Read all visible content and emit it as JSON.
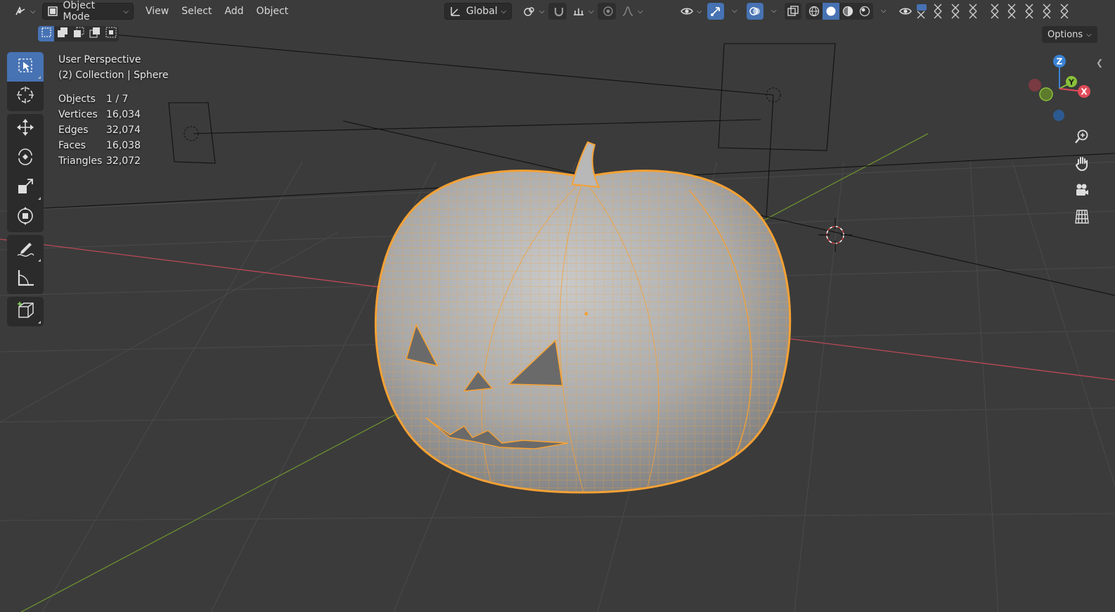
{
  "header": {
    "mode_label": "Object Mode",
    "menus": [
      "View",
      "Select",
      "Add",
      "Object"
    ],
    "transform_orientation": "Global",
    "options_label": "Options"
  },
  "overlay": {
    "view_name": "User Perspective",
    "collection_line": "(2) Collection | Sphere",
    "stats": [
      {
        "label": "Objects",
        "value": "1 / 7"
      },
      {
        "label": "Vertices",
        "value": "16,034"
      },
      {
        "label": "Edges",
        "value": "32,074"
      },
      {
        "label": "Faces",
        "value": "16,038"
      },
      {
        "label": "Triangles",
        "value": "32,072"
      }
    ]
  },
  "gizmo": {
    "x": "X",
    "y": "Y",
    "z": "Z"
  },
  "toolbar": {
    "tools": [
      "select-box-tool",
      "cursor-tool",
      "move-tool",
      "rotate-tool",
      "scale-tool",
      "transform-tool",
      "annotate-tool",
      "measure-tool",
      "add-cube-tool"
    ],
    "active": "select-box-tool"
  },
  "colors": {
    "accent": "#4772b3",
    "selection": "#f5a134",
    "x_axis": "#e04a58",
    "y_axis": "#89c23a",
    "z_axis": "#3b83d6",
    "viewport_bg": "#3b3b3b"
  },
  "icons": {
    "editor_type": "editor-type-icon",
    "mode": "object-mode-icon",
    "orientation": "transform-orientation-icon",
    "pivot": "pivot-point-icon",
    "snap": "snap-magnet-icon",
    "proportional": "proportional-edit-icon",
    "visibility": "eye-icon",
    "gizmo_toggle": "gizmo-toggle-icon",
    "overlays": "overlays-icon",
    "xray": "xray-icon",
    "shading": [
      "wireframe-shading-icon",
      "solid-shading-icon",
      "material-shading-icon",
      "rendered-shading-icon"
    ],
    "nav": [
      "zoom-icon",
      "hand-pan-icon",
      "camera-icon",
      "grid-ortho-icon"
    ]
  }
}
